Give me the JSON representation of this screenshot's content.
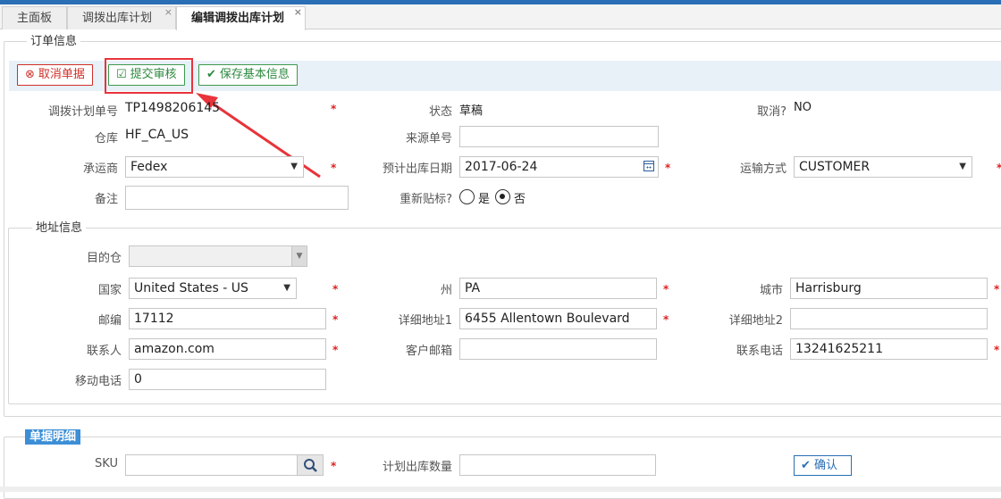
{
  "tabs": [
    {
      "label": "主面板"
    },
    {
      "label": "调拨出库计划",
      "close": "×"
    },
    {
      "label": "编辑调拨出库计划",
      "close": "×"
    }
  ],
  "order_section": {
    "legend": "订单信息",
    "buttons": {
      "cancel": "取消单据",
      "submit": "提交审核",
      "save": "保存基本信息"
    },
    "plan_no": {
      "label": "调拨计划单号",
      "value": "TP1498206145"
    },
    "status": {
      "label": "状态",
      "value": "草稿"
    },
    "cancelled": {
      "label": "取消?",
      "value": "NO"
    },
    "warehouse": {
      "label": "仓库",
      "value": "HF_CA_US"
    },
    "source_no": {
      "label": "来源单号",
      "value": ""
    },
    "carrier": {
      "label": "承运商",
      "value": "Fedex"
    },
    "planned_date": {
      "label": "预计出库日期",
      "value": "2017-06-24"
    },
    "shipping_method": {
      "label": "运输方式",
      "value": "CUSTOMER"
    },
    "remark": {
      "label": "备注",
      "value": ""
    },
    "relabel": {
      "label": "重新贴标?",
      "options": [
        "是",
        "否"
      ],
      "selected": "否"
    }
  },
  "address_section": {
    "legend": "地址信息",
    "dest_warehouse": {
      "label": "目的仓",
      "value": ""
    },
    "country": {
      "label": "国家",
      "value": "United States - US"
    },
    "state": {
      "label": "州",
      "value": "PA"
    },
    "city": {
      "label": "城市",
      "value": "Harrisburg"
    },
    "zip": {
      "label": "邮编",
      "value": "17112"
    },
    "address1": {
      "label": "详细地址1",
      "value": "6455 Allentown Boulevard"
    },
    "address2": {
      "label": "详细地址2",
      "value": ""
    },
    "contact": {
      "label": "联系人",
      "value": "amazon.com"
    },
    "email": {
      "label": "客户邮箱",
      "value": ""
    },
    "phone": {
      "label": "联系电话",
      "value": "13241625211"
    },
    "mobile": {
      "label": "移动电话",
      "value": "0"
    }
  },
  "detail_section": {
    "tag": "单据明细",
    "sku": {
      "label": "SKU",
      "value": ""
    },
    "quantity": {
      "label": "计划出库数量",
      "value": ""
    },
    "confirm": "确认"
  },
  "required_mark": "*",
  "colors": {
    "accent": "#2a6eb5",
    "required": "#e02020",
    "highlight": "#e8343a"
  },
  "annotation": {
    "type": "red-arrow",
    "points_to": "submit-button"
  }
}
